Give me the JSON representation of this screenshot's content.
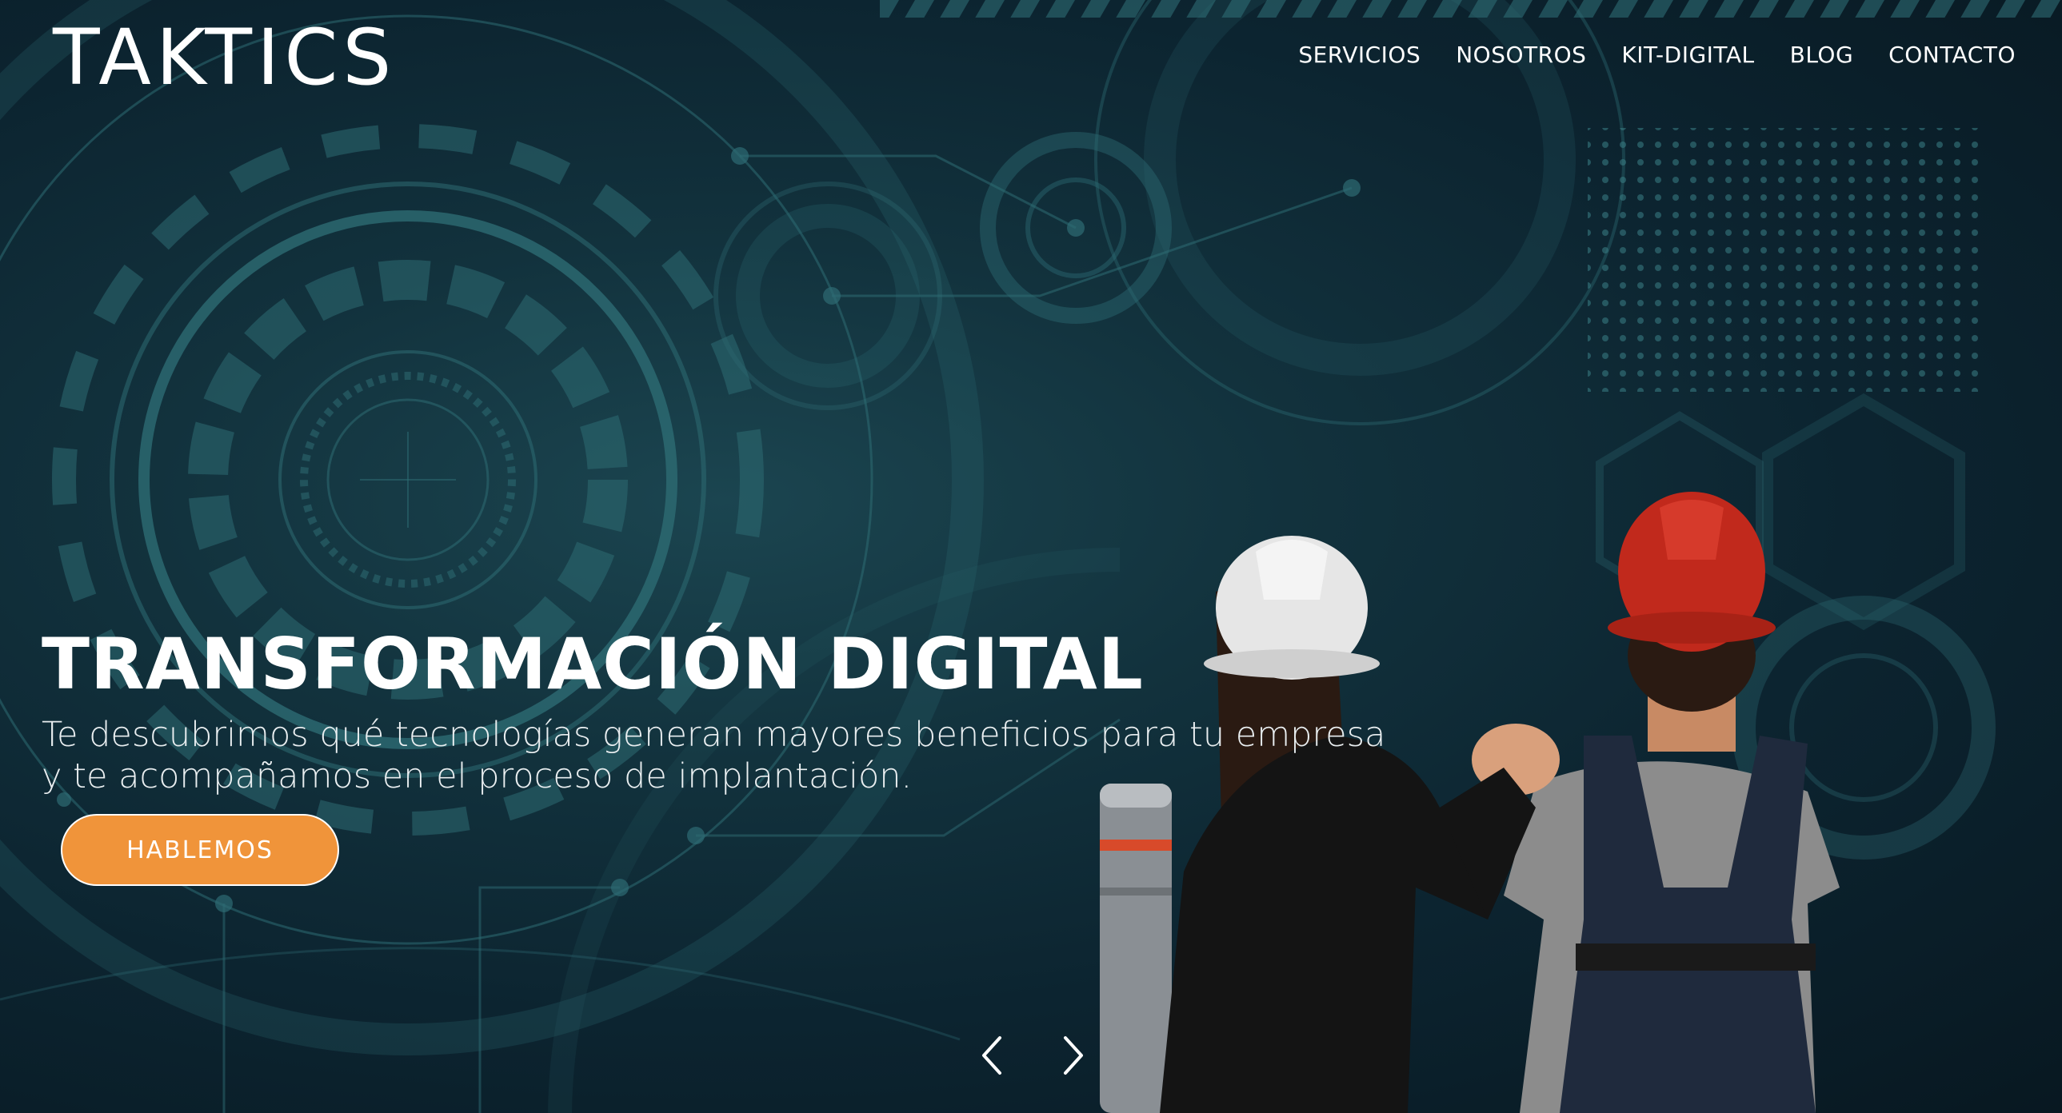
{
  "header": {
    "logo_text": "TAKTICS",
    "nav": [
      {
        "label": "SERVICIOS"
      },
      {
        "label": "NOSOTROS"
      },
      {
        "label": "KIT-DIGITAL"
      },
      {
        "label": "BLOG"
      },
      {
        "label": "CONTACTO"
      }
    ]
  },
  "hero": {
    "title": "TRANSFORMACIÓN DIGITAL",
    "subtitle": "Te descubrimos qué tecnologías generan mayores beneficios para tu empresa y te acompañamos en el proceso de implantación.",
    "cta_label": "HABLEMOS"
  },
  "slider": {
    "prev_icon": "chevron-left-icon",
    "next_icon": "chevron-right-icon"
  },
  "colors": {
    "accent": "#f0943a",
    "background": "#0c2430",
    "text": "#ffffff"
  }
}
